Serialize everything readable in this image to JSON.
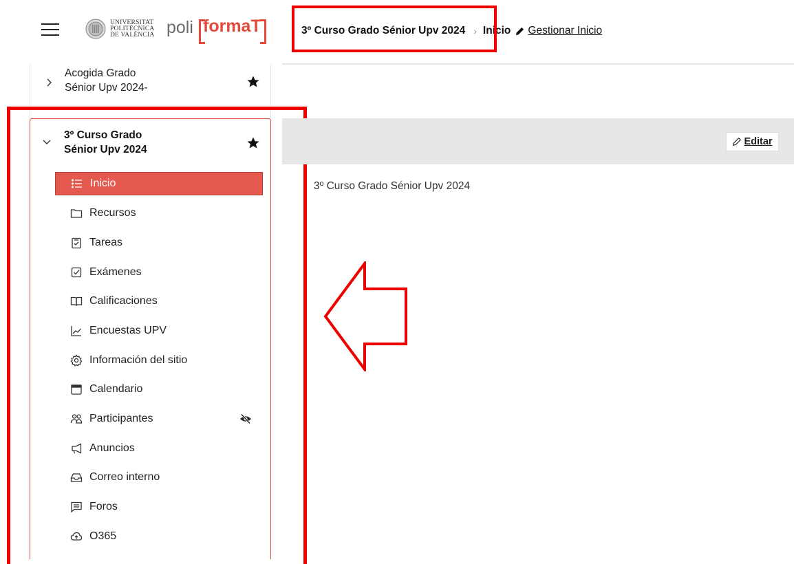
{
  "header": {
    "logo": {
      "university": [
        "UNIVERSITAT",
        "POLITÈCNICA",
        "DE VALÈNCIA"
      ],
      "poli": "poli",
      "brand": "formaT"
    },
    "breadcrumb": {
      "course": "3º Curso Grado Sénior Upv 2024",
      "separator": "›",
      "current": "Inicio",
      "manage_link": "Gestionar Inicio"
    }
  },
  "sidebar": {
    "sites": [
      {
        "title_lines": [
          "Acogida Grado",
          "Sénior Upv 2024-"
        ],
        "expanded": false,
        "favorite": true
      },
      {
        "title_lines": [
          "3º Curso Grado",
          "Sénior Upv 2024"
        ],
        "expanded": true,
        "favorite": true
      }
    ],
    "tools": [
      {
        "label": "Inicio",
        "icon": "list-icon",
        "active": true
      },
      {
        "label": "Recursos",
        "icon": "folder-icon"
      },
      {
        "label": "Tareas",
        "icon": "task-clipboard-icon"
      },
      {
        "label": "Exámenes",
        "icon": "checkbox-icon"
      },
      {
        "label": "Calificaciones",
        "icon": "open-book-icon"
      },
      {
        "label": "Encuestas UPV",
        "icon": "line-chart-icon"
      },
      {
        "label": "Información del sitio",
        "icon": "gear-icon"
      },
      {
        "label": "Calendario",
        "icon": "calendar-icon"
      },
      {
        "label": "Participantes",
        "icon": "people-icon",
        "hidden_indicator": "eye-slash-icon"
      },
      {
        "label": "Anuncios",
        "icon": "megaphone-icon"
      },
      {
        "label": "Correo interno",
        "icon": "inbox-icon"
      },
      {
        "label": "Foros",
        "icon": "chat-icon"
      },
      {
        "label": "O365",
        "icon": "cloud-upload-icon"
      }
    ]
  },
  "main": {
    "edit_label": "Editar",
    "body_text": "3º Curso Grado Sénior Upv 2024"
  },
  "colors": {
    "brand": "#e44a3c",
    "active_item": "#e55a4f",
    "highlight": "#ee0000",
    "band": "#e7e7e7"
  }
}
